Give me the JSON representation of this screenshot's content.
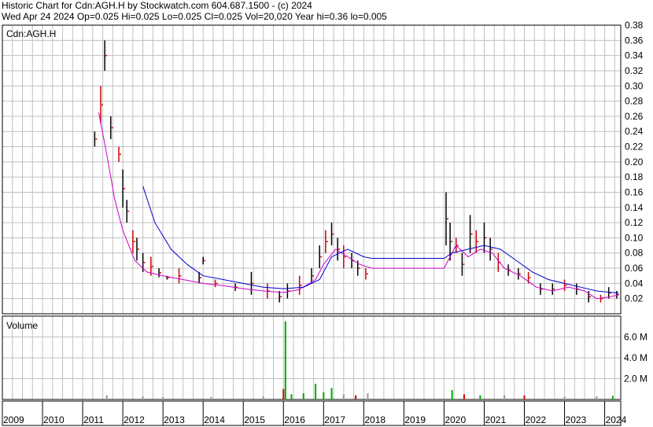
{
  "header": {
    "line1": "Historic Chart for Cdn:AGH.H by Stockwatch.com 604.687.1500 - (c) 2024",
    "line2": "Wed Apr 24 2024   Op=0.025   Hi=0.025   Lo=0.025   Cl=0.025   Vol=20,020   Year hi=0.36   lo=0.005"
  },
  "chart_data": {
    "type": "line",
    "price_panel": {
      "label": "Cdn:AGH.H",
      "ylim": [
        0,
        0.38
      ],
      "yticks": [
        "0.02",
        "0.04",
        "0.06",
        "0.08",
        "0.10",
        "0.12",
        "0.14",
        "0.16",
        "0.18",
        "0.20",
        "0.22",
        "0.24",
        "0.26",
        "0.28",
        "0.30",
        "0.32",
        "0.34",
        "0.36",
        "0.38"
      ],
      "xlim": [
        2009,
        2024.4
      ],
      "grid": true,
      "series": [
        {
          "color": "#cc00cc",
          "points": [
            [
              2011.4,
              0.265
            ],
            [
              2011.6,
              0.21
            ],
            [
              2011.8,
              0.15
            ],
            [
              2012.0,
              0.11
            ],
            [
              2012.3,
              0.07
            ],
            [
              2012.6,
              0.055
            ],
            [
              2013.0,
              0.05
            ],
            [
              2013.5,
              0.045
            ],
            [
              2014.0,
              0.04
            ],
            [
              2014.5,
              0.037
            ],
            [
              2015.0,
              0.033
            ],
            [
              2015.5,
              0.03
            ],
            [
              2016.0,
              0.028
            ],
            [
              2016.4,
              0.032
            ],
            [
              2016.8,
              0.045
            ],
            [
              2017.0,
              0.065
            ],
            [
              2017.3,
              0.085
            ],
            [
              2017.6,
              0.075
            ],
            [
              2017.9,
              0.065
            ],
            [
              2018.2,
              0.06
            ],
            [
              2018.5,
              0.06
            ],
            [
              2020.0,
              0.06
            ],
            [
              2020.3,
              0.09
            ],
            [
              2020.6,
              0.075
            ],
            [
              2020.9,
              0.085
            ],
            [
              2021.2,
              0.08
            ],
            [
              2021.5,
              0.06
            ],
            [
              2021.9,
              0.05
            ],
            [
              2022.3,
              0.035
            ],
            [
              2022.7,
              0.03
            ],
            [
              2023.1,
              0.035
            ],
            [
              2023.5,
              0.03
            ],
            [
              2023.8,
              0.02
            ],
            [
              2024.1,
              0.022
            ],
            [
              2024.35,
              0.025
            ]
          ]
        },
        {
          "color": "#0000cc",
          "points": [
            [
              2012.5,
              0.168
            ],
            [
              2012.8,
              0.12
            ],
            [
              2013.2,
              0.085
            ],
            [
              2013.6,
              0.065
            ],
            [
              2014.0,
              0.05
            ],
            [
              2014.5,
              0.045
            ],
            [
              2015.0,
              0.04
            ],
            [
              2015.5,
              0.035
            ],
            [
              2016.0,
              0.033
            ],
            [
              2016.5,
              0.035
            ],
            [
              2016.9,
              0.045
            ],
            [
              2017.2,
              0.075
            ],
            [
              2017.6,
              0.085
            ],
            [
              2018.0,
              0.075
            ],
            [
              2018.2,
              0.073
            ],
            [
              2020.0,
              0.073
            ],
            [
              2020.2,
              0.08
            ],
            [
              2020.6,
              0.085
            ],
            [
              2021.0,
              0.09
            ],
            [
              2021.4,
              0.085
            ],
            [
              2021.8,
              0.07
            ],
            [
              2022.2,
              0.055
            ],
            [
              2022.6,
              0.045
            ],
            [
              2023.0,
              0.04
            ],
            [
              2023.4,
              0.035
            ],
            [
              2023.8,
              0.03
            ],
            [
              2024.2,
              0.028
            ],
            [
              2024.35,
              0.027
            ]
          ]
        }
      ],
      "price_bars": [
        [
          2011.3,
          0.22,
          0.24
        ],
        [
          2011.45,
          0.25,
          0.3
        ],
        [
          2011.55,
          0.32,
          0.36
        ],
        [
          2011.7,
          0.23,
          0.26
        ],
        [
          2011.9,
          0.2,
          0.22
        ],
        [
          2012.0,
          0.14,
          0.19
        ],
        [
          2012.1,
          0.12,
          0.15
        ],
        [
          2012.25,
          0.08,
          0.11
        ],
        [
          2012.35,
          0.07,
          0.1
        ],
        [
          2012.5,
          0.055,
          0.08
        ],
        [
          2012.7,
          0.05,
          0.075
        ],
        [
          2012.9,
          0.048,
          0.06
        ],
        [
          2013.1,
          0.045,
          0.05
        ],
        [
          2013.4,
          0.04,
          0.06
        ],
        [
          2013.9,
          0.04,
          0.055
        ],
        [
          2014.0,
          0.065,
          0.075
        ],
        [
          2014.3,
          0.035,
          0.045
        ],
        [
          2014.8,
          0.03,
          0.04
        ],
        [
          2015.2,
          0.025,
          0.055
        ],
        [
          2015.6,
          0.02,
          0.04
        ],
        [
          2015.9,
          0.015,
          0.03
        ],
        [
          2016.1,
          0.02,
          0.04
        ],
        [
          2016.4,
          0.025,
          0.05
        ],
        [
          2016.7,
          0.04,
          0.06
        ],
        [
          2016.9,
          0.06,
          0.09
        ],
        [
          2017.05,
          0.08,
          0.11
        ],
        [
          2017.2,
          0.09,
          0.12
        ],
        [
          2017.35,
          0.07,
          0.1
        ],
        [
          2017.5,
          0.06,
          0.09
        ],
        [
          2017.7,
          0.06,
          0.08
        ],
        [
          2017.85,
          0.05,
          0.07
        ],
        [
          2018.05,
          0.045,
          0.06
        ],
        [
          2020.05,
          0.09,
          0.16
        ],
        [
          2020.15,
          0.07,
          0.12
        ],
        [
          2020.3,
          0.08,
          0.1
        ],
        [
          2020.45,
          0.05,
          0.08
        ],
        [
          2020.65,
          0.08,
          0.13
        ],
        [
          2020.8,
          0.08,
          0.11
        ],
        [
          2021.0,
          0.08,
          0.12
        ],
        [
          2021.15,
          0.07,
          0.1
        ],
        [
          2021.35,
          0.055,
          0.08
        ],
        [
          2021.6,
          0.05,
          0.065
        ],
        [
          2021.85,
          0.045,
          0.06
        ],
        [
          2022.1,
          0.04,
          0.055
        ],
        [
          2022.4,
          0.025,
          0.04
        ],
        [
          2022.7,
          0.025,
          0.04
        ],
        [
          2023.0,
          0.03,
          0.045
        ],
        [
          2023.3,
          0.025,
          0.04
        ],
        [
          2023.6,
          0.015,
          0.03
        ],
        [
          2023.9,
          0.015,
          0.025
        ],
        [
          2024.1,
          0.02,
          0.035
        ],
        [
          2024.3,
          0.02,
          0.03
        ]
      ]
    },
    "volume_panel": {
      "label": "Volume",
      "ylim": [
        0,
        8
      ],
      "yticks": [
        "2.0 M",
        "4.0 M",
        "6.0 M"
      ],
      "bars": [
        [
          2011.6,
          0.4,
          "#999999"
        ],
        [
          2012.5,
          0.3,
          "#999999"
        ],
        [
          2013.0,
          0.25,
          "#999999"
        ],
        [
          2014.2,
          0.25,
          "#999999"
        ],
        [
          2015.5,
          0.3,
          "#999999"
        ],
        [
          2016.0,
          1.0,
          "#cc0000"
        ],
        [
          2016.05,
          7.5,
          "#00aa00"
        ],
        [
          2016.2,
          0.5,
          "#00aa00"
        ],
        [
          2016.5,
          0.6,
          "#00aa00"
        ],
        [
          2016.8,
          1.5,
          "#00aa00"
        ],
        [
          2017.0,
          0.7,
          "#00aa00"
        ],
        [
          2017.2,
          1.1,
          "#00aa00"
        ],
        [
          2017.5,
          0.5,
          "#999999"
        ],
        [
          2017.8,
          0.4,
          "#cc0000"
        ],
        [
          2018.1,
          0.6,
          "#999999"
        ],
        [
          2020.2,
          0.9,
          "#00aa00"
        ],
        [
          2020.5,
          0.5,
          "#cc0000"
        ],
        [
          2020.9,
          0.4,
          "#00aa00"
        ],
        [
          2021.5,
          0.4,
          "#999999"
        ],
        [
          2022.0,
          0.4,
          "#cc0000"
        ],
        [
          2023.0,
          0.3,
          "#999999"
        ],
        [
          2023.8,
          0.3,
          "#999999"
        ],
        [
          2024.2,
          0.35,
          "#00aa00"
        ]
      ]
    },
    "x_axis": {
      "labels": [
        "2009",
        "2010",
        "2011",
        "2012",
        "2013",
        "2014",
        "2015",
        "2016",
        "2017",
        "2018",
        "2019",
        "2020",
        "2021",
        "2022",
        "2023",
        "2024"
      ]
    },
    "colors": {
      "up": "#000000",
      "down": "#cc0000",
      "grid": "#c0c0c0"
    }
  }
}
